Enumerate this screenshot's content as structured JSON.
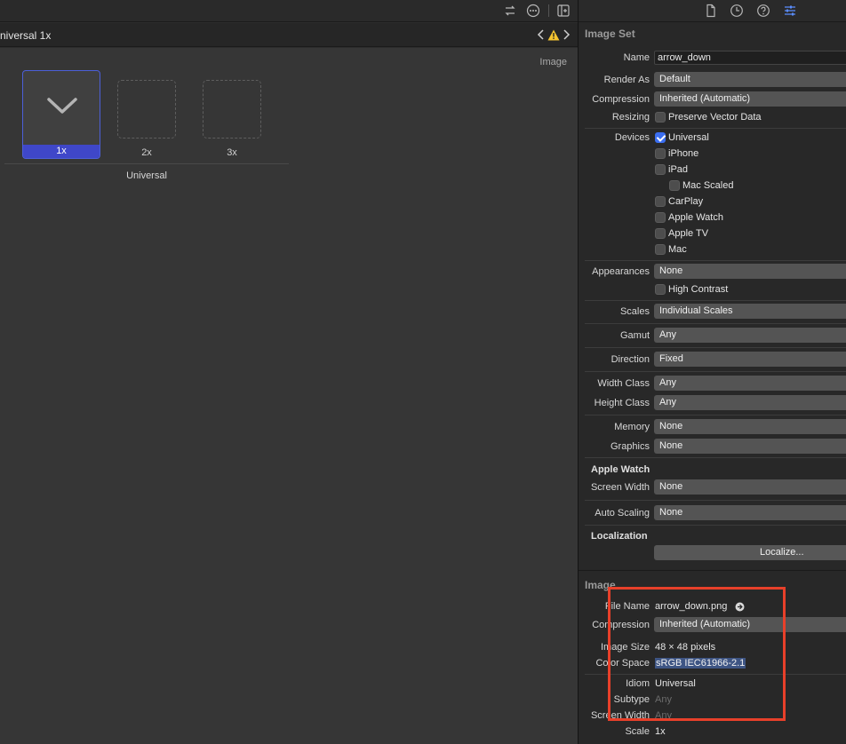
{
  "editor": {
    "jumpbar_title": "niversal 1x",
    "canvas_label": "Image",
    "slots": [
      {
        "label": "1x",
        "filled": true
      },
      {
        "label": "2x",
        "filled": false
      },
      {
        "label": "3x",
        "filled": false
      }
    ],
    "group_label": "Universal",
    "icons": [
      "swap-icon",
      "more-icon",
      "add-editor-icon",
      "chevron-left-icon",
      "warning-icon",
      "chevron-right-icon",
      "chevron-down-icon"
    ]
  },
  "inspector": {
    "tabs": [
      "file-icon",
      "history-icon",
      "help-icon",
      "attributes-icon"
    ],
    "image_set": {
      "title": "Image Set",
      "name_label": "Name",
      "name_value": "arrow_down",
      "render_as_label": "Render As",
      "render_as_value": "Default",
      "compression_label": "Compression",
      "compression_value": "Inherited (Automatic)",
      "resizing_label": "Resizing",
      "preserve_vector": "Preserve Vector Data",
      "devices_label": "Devices",
      "devices": [
        {
          "label": "Universal",
          "checked": true
        },
        {
          "label": "iPhone",
          "checked": false
        },
        {
          "label": "iPad",
          "checked": false
        },
        {
          "label": "Mac Scaled",
          "checked": false
        },
        {
          "label": "CarPlay",
          "checked": false
        },
        {
          "label": "Apple Watch",
          "checked": false
        },
        {
          "label": "Apple TV",
          "checked": false
        },
        {
          "label": "Mac",
          "checked": false
        }
      ],
      "appearances_label": "Appearances",
      "appearances_value": "None",
      "high_contrast": "High Contrast",
      "scales_label": "Scales",
      "scales_value": "Individual Scales",
      "gamut_label": "Gamut",
      "gamut_value": "Any",
      "direction_label": "Direction",
      "direction_value": "Fixed",
      "width_class_label": "Width Class",
      "width_class_value": "Any",
      "height_class_label": "Height Class",
      "height_class_value": "Any",
      "memory_label": "Memory",
      "memory_value": "None",
      "graphics_label": "Graphics",
      "graphics_value": "None",
      "apple_watch_title": "Apple Watch",
      "screen_width_label": "Screen Width",
      "screen_width_value": "None",
      "auto_scaling_label": "Auto Scaling",
      "auto_scaling_value": "None",
      "localization_title": "Localization",
      "localize_button": "Localize..."
    },
    "image": {
      "title": "Image",
      "file_name_label": "File Name",
      "file_name_value": "arrow_down.png",
      "compression_label": "Compression",
      "compression_value": "Inherited (Automatic)",
      "image_size_label": "Image Size",
      "image_size_value": "48 × 48 pixels",
      "color_space_label": "Color Space",
      "color_space_value": "sRGB IEC61966-2.1",
      "idiom_label": "Idiom",
      "idiom_value": "Universal",
      "subtype_label": "Subtype",
      "subtype_value": "Any",
      "screen_width_label": "Screen Width",
      "screen_width_value": "Any",
      "scale_label": "Scale",
      "scale_value": "1x"
    }
  },
  "colors": {
    "accent": "#3b6ef0",
    "highlight_box": "#e8402a",
    "selected_slot": "#3f47c9"
  }
}
